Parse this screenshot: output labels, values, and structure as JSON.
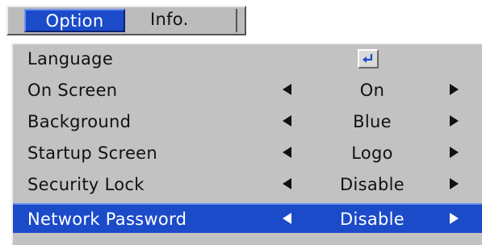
{
  "tabs": [
    {
      "label": "Option",
      "active": true
    },
    {
      "label": "Info.",
      "active": false
    }
  ],
  "menu": {
    "items": [
      {
        "label": "Language",
        "value": "",
        "control": "enter",
        "icon": "enter-key-icon"
      },
      {
        "label": "On Screen",
        "value": "On",
        "control": "select"
      },
      {
        "label": "Background",
        "value": "Blue",
        "control": "select"
      },
      {
        "label": "Startup Screen",
        "value": "Logo",
        "control": "select"
      },
      {
        "label": "Security Lock",
        "value": "Disable",
        "control": "select"
      },
      {
        "label": "Network Password",
        "value": "Disable",
        "control": "select",
        "selected": true
      }
    ]
  },
  "colors": {
    "highlight": "#1b4bc9",
    "panel": "#c2c2c2",
    "text": "#111111",
    "highlight_text": "#ffffff"
  }
}
